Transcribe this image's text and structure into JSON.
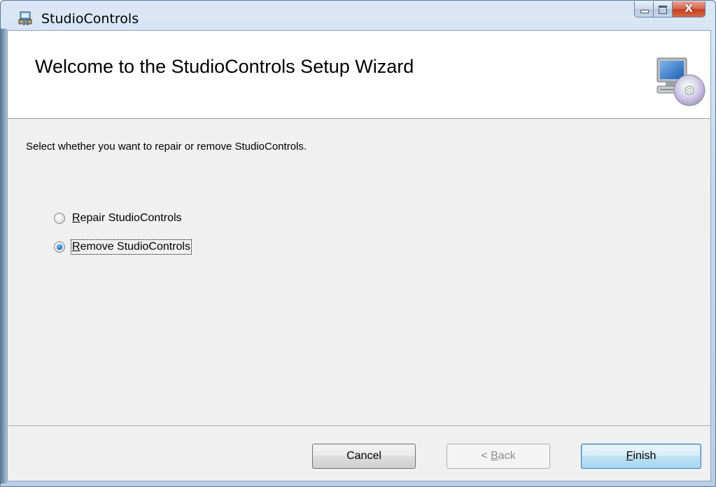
{
  "window": {
    "title": "StudioControls",
    "caption_buttons": {
      "minimize_icon": "minimize-icon",
      "maximize_icon": "maximize-icon",
      "close_glyph": "X"
    }
  },
  "banner": {
    "title": "Welcome to the StudioControls Setup Wizard",
    "icon": "computer-disc-icon"
  },
  "instruction": "Select whether you want to repair or remove StudioControls.",
  "options": [
    {
      "label_accel": "R",
      "label_rest": "epair StudioControls",
      "selected": false
    },
    {
      "label_accel": "R",
      "label_rest": "emove StudioControls",
      "selected": true
    }
  ],
  "buttons": {
    "cancel": {
      "label": "Cancel",
      "enabled": true
    },
    "back": {
      "label_prefix": "< ",
      "label_accel": "B",
      "label_rest": "ack",
      "enabled": false
    },
    "finish": {
      "label_accel": "F",
      "label_rest": "inish",
      "enabled": true,
      "default": true
    }
  },
  "colors": {
    "accent": "#3c7fb1",
    "radio_selected": "#1c78c9",
    "close_button": "#c4401f"
  }
}
